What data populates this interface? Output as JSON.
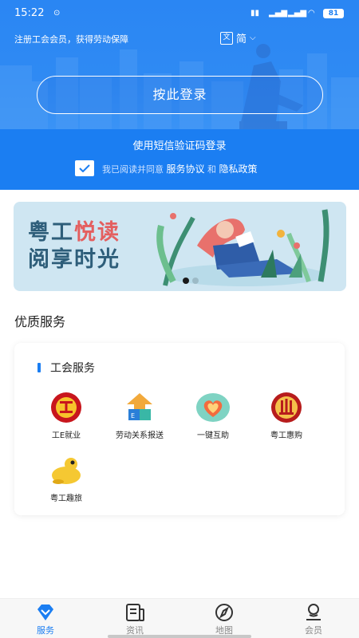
{
  "status": {
    "time": "15:22",
    "battery": "81"
  },
  "header": {
    "promo": "注册工会会员，获得劳动保障",
    "language": "简",
    "login_button": "按此登录",
    "sms_login": "使用短信验证码登录",
    "agree_prefix": "我已阅读并同意",
    "service_agreement": "服务协议",
    "and": "和",
    "privacy_policy": "隐私政策",
    "agree_checked": true
  },
  "banner": {
    "line1_a": "粤工",
    "line1_b": "悦读",
    "line2": "阅享时光",
    "slide_index": 1,
    "slide_count": 2
  },
  "section": {
    "title": "优质服务"
  },
  "card": {
    "title": "工会服务",
    "services": [
      {
        "label": "工E就业",
        "icon": "union-emblem-icon"
      },
      {
        "label": "劳动关系报送",
        "icon": "upload-report-icon"
      },
      {
        "label": "一键互助",
        "icon": "heart-help-icon"
      },
      {
        "label": "粤工惠购",
        "icon": "shopping-emblem-icon"
      },
      {
        "label": "粤工趣旅",
        "icon": "frog-travel-icon"
      }
    ]
  },
  "tabs": [
    {
      "label": "服务",
      "icon": "diamond-icon",
      "active": true
    },
    {
      "label": "资讯",
      "icon": "news-icon",
      "active": false
    },
    {
      "label": "地图",
      "icon": "compass-icon",
      "active": false
    },
    {
      "label": "会员",
      "icon": "user-icon",
      "active": false
    }
  ],
  "colors": {
    "primary": "#1b7ef2",
    "text": "#222222",
    "muted": "#888888"
  }
}
